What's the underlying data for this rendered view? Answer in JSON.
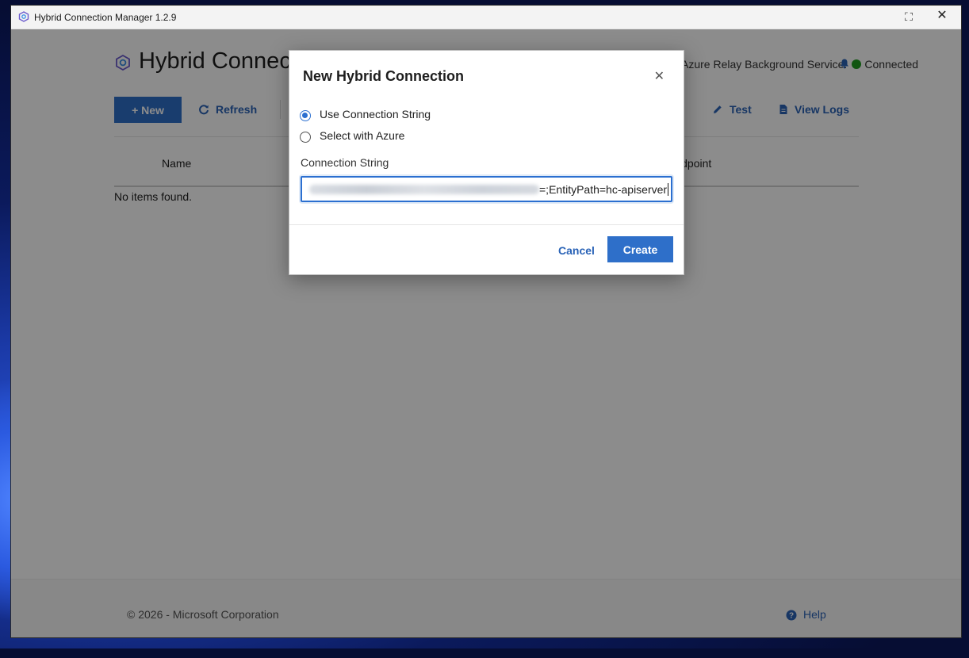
{
  "window": {
    "title": "Hybrid Connection Manager 1.2.9"
  },
  "header": {
    "page_title": "Hybrid Connections",
    "status_label": "Azure Relay Background Service:",
    "status_value": "Connected",
    "status_color": "#1f9d1f"
  },
  "toolbar": {
    "new_label": "New",
    "refresh_label": "Refresh",
    "test_label": "Test",
    "view_logs_label": "View Logs"
  },
  "table": {
    "columns": [
      "Name",
      "Endpoint"
    ],
    "empty_message": "No items found."
  },
  "footer": {
    "copyright": "© 2026 - Microsoft Corporation",
    "help_label": "Help"
  },
  "dialog": {
    "title": "New Hybrid Connection",
    "options": [
      {
        "label": "Use Connection String",
        "selected": true
      },
      {
        "label": "Select with Azure",
        "selected": false
      }
    ],
    "connection_string_label": "Connection String",
    "connection_string_visible_value": "=;EntityPath=hc-apiserver",
    "cancel_label": "Cancel",
    "create_label": "Create"
  },
  "colors": {
    "accent": "#2e6fc9",
    "link": "#2a63b7"
  }
}
